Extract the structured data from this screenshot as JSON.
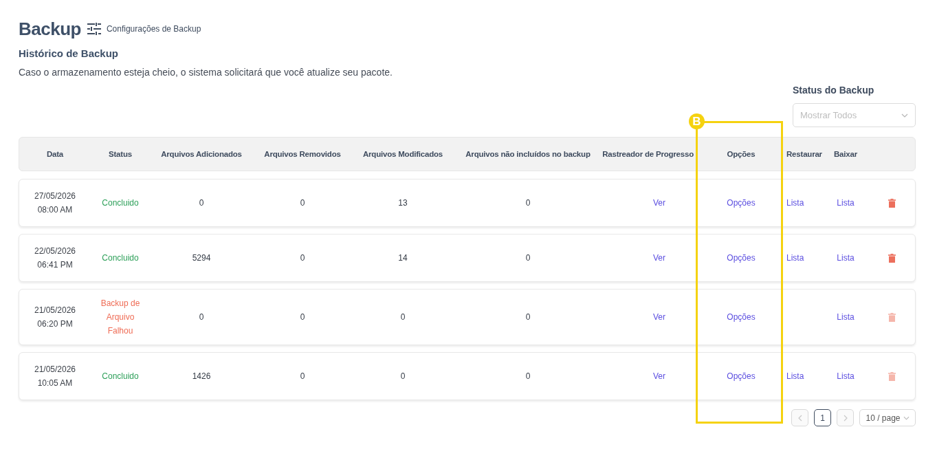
{
  "header": {
    "title": "Backup",
    "settings_link": "Configurações de Backup"
  },
  "section": {
    "title": "Histórico de Backup",
    "note": "Caso o armazenamento esteja cheio, o sistema solicitará que você atualize seu pacote."
  },
  "filter": {
    "label": "Status do Backup",
    "placeholder": "Mostrar Todos"
  },
  "table": {
    "columns": [
      "Data",
      "Status",
      "Arquivos Adicionados",
      "Arquivos Removidos",
      "Arquivos Modificados",
      "Arquivos não incluídos no backup",
      "Rastreador de Progresso",
      "Opções",
      "Restaurar",
      "Baixar"
    ],
    "rows": [
      {
        "date": "27/05/2026",
        "time": "08:00 AM",
        "status": {
          "label": "Concluido",
          "kind": "success"
        },
        "added": "0",
        "removed": "0",
        "modified": "13",
        "excluded": "0",
        "progress": "Ver",
        "options": "Opções",
        "restore": "Lista",
        "download": "Lista",
        "delete_disabled": false
      },
      {
        "date": "22/05/2026",
        "time": "06:41 PM",
        "status": {
          "label": "Concluido",
          "kind": "success"
        },
        "added": "5294",
        "removed": "0",
        "modified": "14",
        "excluded": "0",
        "progress": "Ver",
        "options": "Opções",
        "restore": "Lista",
        "download": "Lista",
        "delete_disabled": false
      },
      {
        "date": "21/05/2026",
        "time": "06:20 PM",
        "status": {
          "label": "Backup de Arquivo Falhou",
          "kind": "failed"
        },
        "added": "0",
        "removed": "0",
        "modified": "0",
        "excluded": "0",
        "progress": "Ver",
        "options": "Opções",
        "download": "Lista",
        "delete_disabled": true
      },
      {
        "date": "21/05/2026",
        "time": "10:05 AM",
        "status": {
          "label": "Concluido",
          "kind": "success"
        },
        "added": "1426",
        "removed": "0",
        "modified": "0",
        "excluded": "0",
        "progress": "Ver",
        "options": "Opções",
        "restore": "Lista",
        "download": "Lista",
        "delete_disabled": true
      }
    ]
  },
  "pagination": {
    "prev_disabled": true,
    "pages": [
      {
        "label": "1",
        "selected": true
      }
    ],
    "next_disabled": true,
    "page_size": "10 / page"
  },
  "annotation": {
    "label": "B"
  }
}
